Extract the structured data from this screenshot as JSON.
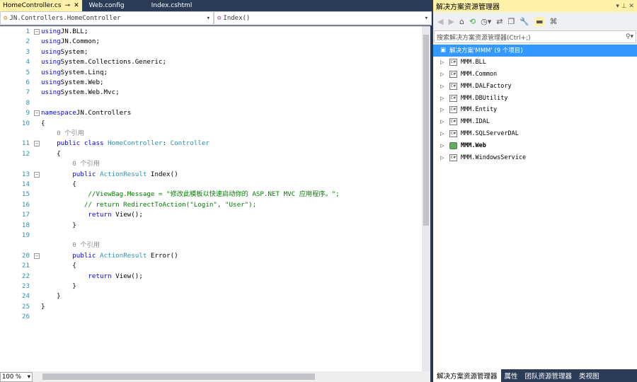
{
  "tabs": [
    {
      "label": "HomeController.cs",
      "active": true
    },
    {
      "label": "Web.config"
    },
    {
      "label": "Index.cshtml"
    }
  ],
  "navbar": {
    "class_combo": "JN.Controllers.HomeController",
    "member_combo": "Index()"
  },
  "code_rows": [
    {
      "n": "1",
      "fold": "−",
      "t": [
        [
          "kw",
          "using"
        ],
        [
          "",
          "JN.BLL;"
        ]
      ]
    },
    {
      "n": "2",
      "t": [
        [
          "kw",
          "using"
        ],
        [
          "",
          "JN.Common;"
        ]
      ]
    },
    {
      "n": "3",
      "t": [
        [
          "kw",
          "using"
        ],
        [
          "",
          "System;"
        ]
      ]
    },
    {
      "n": "4",
      "t": [
        [
          "kw",
          "using"
        ],
        [
          "",
          "System.Collections.Generic;"
        ]
      ]
    },
    {
      "n": "5",
      "t": [
        [
          "kw",
          "using"
        ],
        [
          "",
          "System.Linq;"
        ]
      ]
    },
    {
      "n": "6",
      "t": [
        [
          "kw",
          "using"
        ],
        [
          "",
          "System.Web;"
        ]
      ]
    },
    {
      "n": "7",
      "t": [
        [
          "kw",
          "using"
        ],
        [
          "",
          "System.Web.Mvc;"
        ]
      ]
    },
    {
      "n": "8",
      "t": []
    },
    {
      "n": "9",
      "fold": "−",
      "t": [
        [
          "kw",
          "namespace"
        ],
        [
          "",
          "JN.Controllers"
        ]
      ]
    },
    {
      "n": "10",
      "t": [
        [
          "",
          "{"
        ]
      ]
    },
    {
      "n": "",
      "t": [
        [
          "lens",
          "    0 个引用"
        ]
      ]
    },
    {
      "n": "11",
      "fold": "−",
      "t": [
        [
          "",
          "    "
        ],
        [
          "kw",
          "public class "
        ],
        [
          "ty",
          "HomeController"
        ],
        [
          "",
          ": "
        ],
        [
          "ty",
          "Controller"
        ]
      ]
    },
    {
      "n": "12",
      "t": [
        [
          "",
          "    {"
        ]
      ]
    },
    {
      "n": "",
      "t": [
        [
          "lens",
          "        0 个引用"
        ]
      ]
    },
    {
      "n": "13",
      "fold": "−",
      "t": [
        [
          "",
          "        "
        ],
        [
          "kw",
          "public "
        ],
        [
          "ty",
          "ActionResult"
        ],
        [
          "",
          " Index()"
        ]
      ]
    },
    {
      "n": "14",
      "t": [
        [
          "",
          "        {"
        ]
      ]
    },
    {
      "n": "15",
      "t": [
        [
          "",
          "            "
        ],
        [
          "cm",
          "//ViewBag.Message = \"修改此模板以快速启动你的 ASP.NET MVC 应用程序。\";"
        ]
      ]
    },
    {
      "n": "16",
      "t": [
        [
          "",
          "           "
        ],
        [
          "cm",
          "// return RedirectToAction(\"Login\", \"User\");"
        ]
      ]
    },
    {
      "n": "17",
      "t": [
        [
          "",
          "            "
        ],
        [
          "kw",
          "return"
        ],
        [
          "",
          " View();"
        ]
      ]
    },
    {
      "n": "18",
      "t": [
        [
          "",
          "        }"
        ]
      ]
    },
    {
      "n": "19",
      "t": []
    },
    {
      "n": "",
      "t": [
        [
          "lens",
          "        0 个引用"
        ]
      ]
    },
    {
      "n": "20",
      "fold": "−",
      "t": [
        [
          "",
          "        "
        ],
        [
          "kw",
          "public "
        ],
        [
          "ty",
          "ActionResult"
        ],
        [
          "",
          " Error()"
        ]
      ]
    },
    {
      "n": "21",
      "t": [
        [
          "",
          "        {"
        ]
      ]
    },
    {
      "n": "22",
      "t": [
        [
          "",
          "            "
        ],
        [
          "kw",
          "return"
        ],
        [
          "",
          " View();"
        ]
      ]
    },
    {
      "n": "23",
      "t": [
        [
          "",
          "        }"
        ]
      ]
    },
    {
      "n": "24",
      "t": [
        [
          "",
          "    }"
        ]
      ]
    },
    {
      "n": "25",
      "t": [
        [
          "",
          "}"
        ]
      ]
    },
    {
      "n": "26",
      "t": []
    }
  ],
  "zoom": "100 %",
  "solution_explorer": {
    "title": "解决方案资源管理器",
    "search_placeholder": "搜索解决方案资源管理器(Ctrl+;)",
    "root": "解决方案'MMM' (9 个项目)",
    "projects": [
      {
        "name": "MMM.BLL"
      },
      {
        "name": "MMM.Common"
      },
      {
        "name": "MMM.DALFactory"
      },
      {
        "name": "MMM.DBUtility"
      },
      {
        "name": "MMM.Entity"
      },
      {
        "name": "MMM.IDAL"
      },
      {
        "name": "MMM.SQLServerDAL"
      },
      {
        "name": "MMM.Web",
        "web": true
      },
      {
        "name": "MMM.WindowsService"
      }
    ],
    "bottom_tabs": [
      "解决方案资源管理器",
      "属性",
      "团队资源管理器",
      "类视图"
    ]
  }
}
